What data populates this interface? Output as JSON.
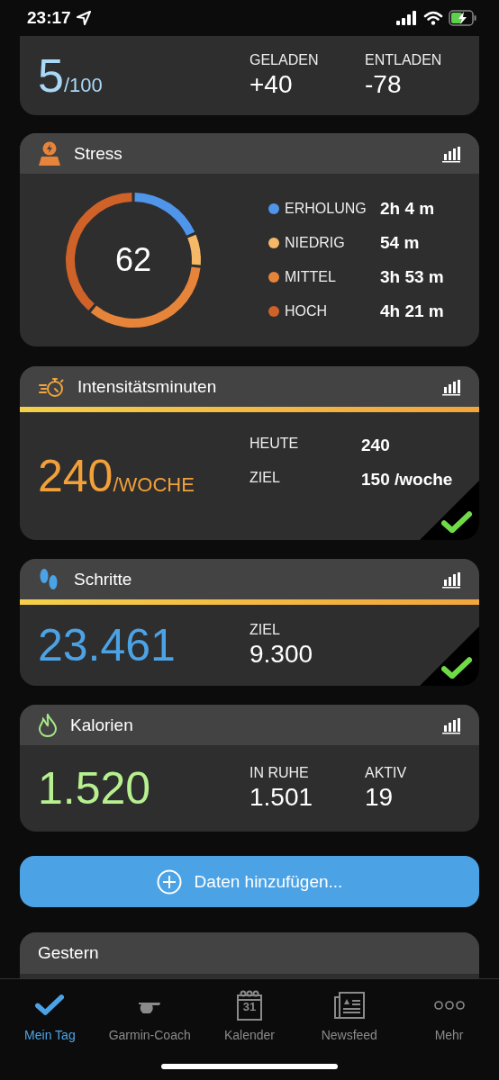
{
  "status_bar": {
    "time": "23:17"
  },
  "body_battery": {
    "value": "5",
    "max": "/100",
    "stats": [
      {
        "label": "GELADEN",
        "value": "+40"
      },
      {
        "label": "ENTLADEN",
        "value": "-78"
      }
    ]
  },
  "stress": {
    "title": "Stress",
    "score": "62",
    "chart_data": {
      "type": "donut",
      "categories": [
        "ERHOLUNG",
        "NIEDRIG",
        "MITTEL",
        "HOCH"
      ],
      "values": [
        18.5,
        8,
        34.7,
        38.8
      ]
    },
    "legend": [
      {
        "value": "2h 4 m",
        "color": "#4f95ea"
      },
      {
        "value": "54 m",
        "color": "#f4b867"
      },
      {
        "value": "3h 53 m",
        "color": "#e6843a"
      },
      {
        "value": "4h 21 m",
        "color": "#cf6228"
      }
    ]
  },
  "intensity": {
    "title": "Intensitätsminuten",
    "value": "240",
    "unit": "/WOCHE",
    "goal_reached": true,
    "stats": [
      {
        "label": "HEUTE",
        "value": "240"
      },
      {
        "label": "ZIEL",
        "value": "150 /woche"
      }
    ]
  },
  "steps": {
    "title": "Schritte",
    "value": "23.461",
    "goal_reached": true,
    "stats": [
      {
        "label": "ZIEL",
        "value": "9.300"
      }
    ]
  },
  "calories": {
    "title": "Kalorien",
    "value": "1.520",
    "stats": [
      {
        "label": "IN RUHE",
        "value": "1.501"
      },
      {
        "label": "AKTIV",
        "value": "19"
      }
    ]
  },
  "add_button": {
    "label": "Daten hinzufügen..."
  },
  "yesterday": {
    "title": "Gestern"
  },
  "tab_bar": [
    {
      "kind": "check",
      "label": "Mein Tag",
      "selected": true
    },
    {
      "kind": "whistle",
      "label": "Garmin-Coach",
      "selected": false
    },
    {
      "kind": "calendar",
      "label": "Kalender",
      "icon_text": "31",
      "selected": false
    },
    {
      "kind": "news",
      "label": "Newsfeed",
      "selected": false
    },
    {
      "kind": "more",
      "label": "Mehr",
      "selected": false
    }
  ]
}
